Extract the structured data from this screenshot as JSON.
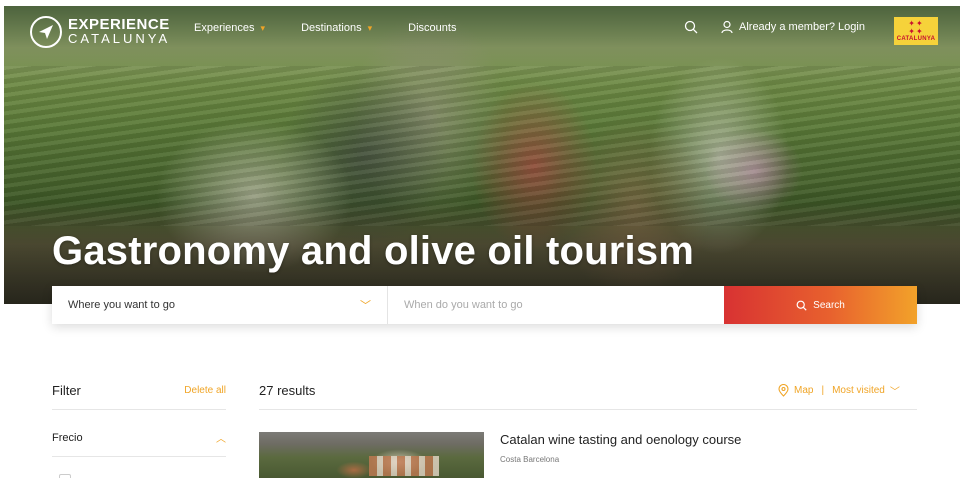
{
  "brand": {
    "line1": "EXPERIENCE",
    "line2": "CATALUNYA"
  },
  "nav": [
    {
      "label": "Experiences",
      "has_dropdown": true
    },
    {
      "label": "Destinations",
      "has_dropdown": true
    },
    {
      "label": "Discounts",
      "has_dropdown": false
    }
  ],
  "header": {
    "login_label": "Already a member? Login",
    "badge_text": "CATALUNYA"
  },
  "hero": {
    "title": "Gastronomy and olive oil tourism"
  },
  "search": {
    "where_label": "Where you want to go",
    "when_placeholder": "When do you want to go",
    "button_label": "Search"
  },
  "filter": {
    "title": "Filter",
    "delete_all": "Delete all",
    "price_label": "Frecio"
  },
  "results": {
    "count_label": "27 results",
    "map_label": "Map",
    "separator": "|",
    "sort_label": "Most visited"
  },
  "cards": [
    {
      "title": "Catalan wine tasting and oenology course",
      "location": "Costa Barcelona"
    }
  ],
  "colors": {
    "accent": "#f0a527",
    "button_start": "#d83232",
    "button_end": "#f2a22a",
    "badge": "#f6d23a"
  },
  "icons": [
    "logo-icon",
    "chevron-down-icon",
    "search-icon",
    "user-icon",
    "map-pin-icon",
    "chevron-up-icon"
  ]
}
